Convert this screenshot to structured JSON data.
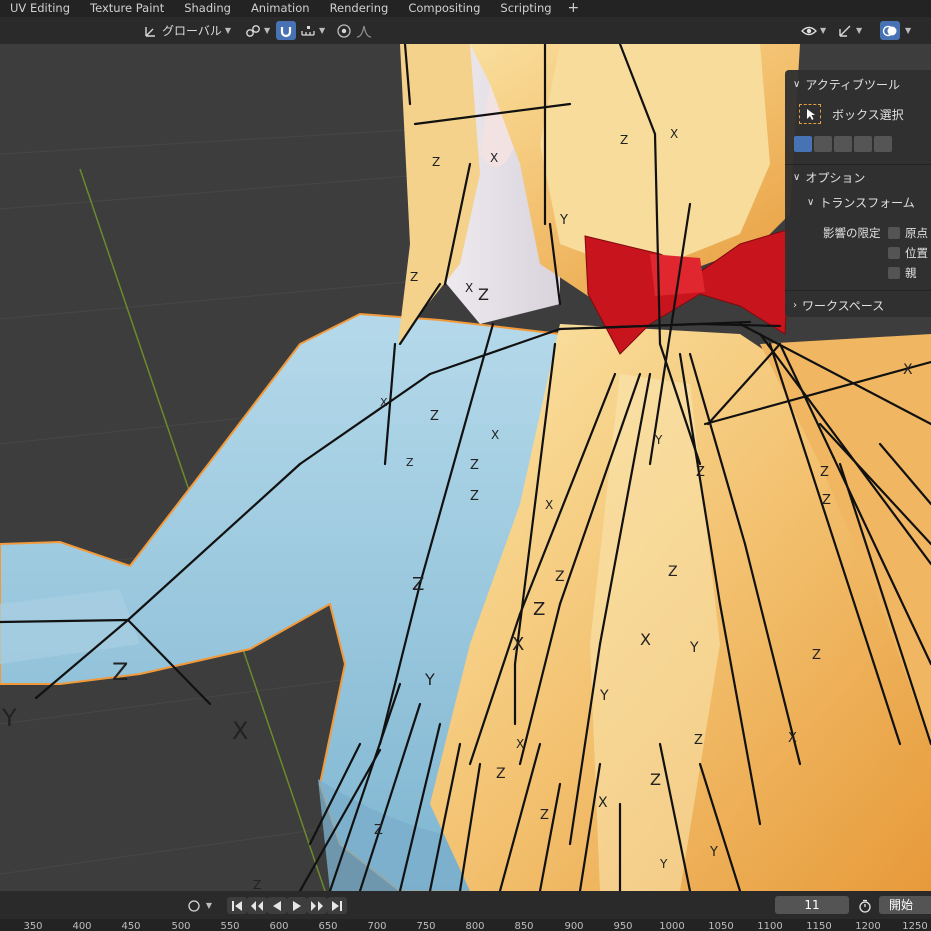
{
  "tabs": [
    "UV Editing",
    "Texture Paint",
    "Shading",
    "Animation",
    "Rendering",
    "Compositing",
    "Scripting"
  ],
  "tab_add": "+",
  "header": {
    "transform_orientation": "グローバル"
  },
  "npanel": {
    "active_tool_title": "アクティブツール",
    "tool_name": "ボックス選択",
    "options_title": "オプション",
    "transform_title": "トランスフォーム",
    "affect_only": "影響の限定",
    "opt_origins": "原点",
    "opt_locations": "位置",
    "opt_parents": "親",
    "workspace_title": "ワークスペース"
  },
  "timeline": {
    "current_frame": "11",
    "start_label": "開始"
  },
  "ruler": [
    "350",
    "400",
    "450",
    "500",
    "550",
    "600",
    "650",
    "700",
    "750",
    "800",
    "850",
    "900",
    "950",
    "1000",
    "1050",
    "1100",
    "1150",
    "1200",
    "1250"
  ],
  "axis_labels": {
    "x": "X",
    "y": "Y",
    "z": "Z"
  },
  "colors": {
    "viewport_bg": "#3d3d3d",
    "selection_outline": "#f29a3a",
    "active_blue": "#4772b3",
    "hair": "#f2c67a",
    "bow": "#c8141c",
    "shirt": "#9ccbe0"
  }
}
